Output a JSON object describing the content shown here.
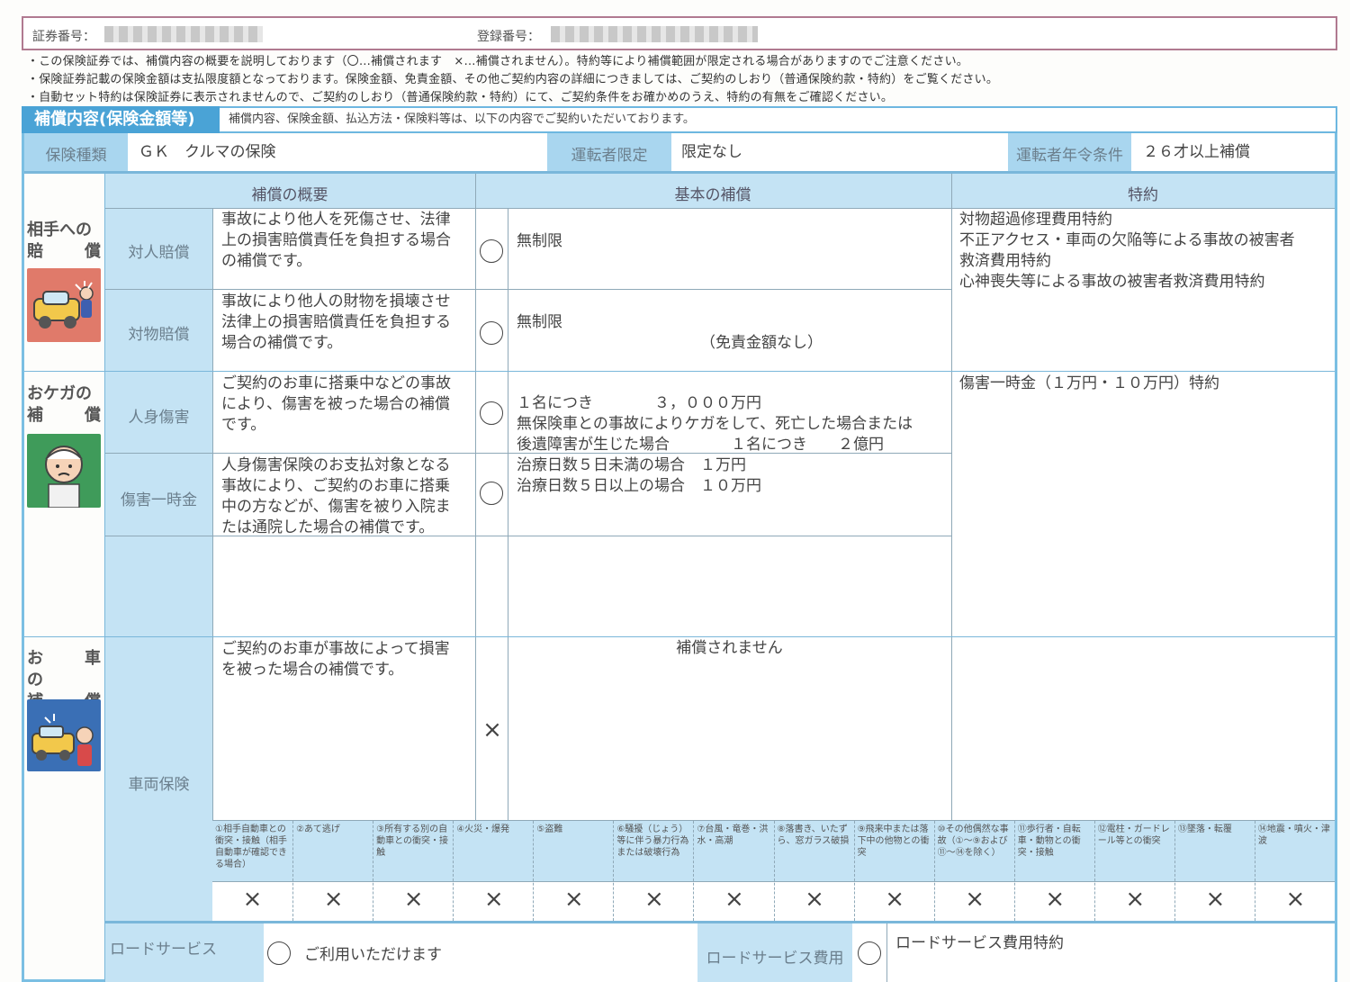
{
  "top": {
    "certificate_label": "証券番号：",
    "registration_label": "登録番号："
  },
  "notes": [
    "・この保険証券では、補償内容の概要を説明しております（〇…補償されます　×…補償されません）。特約等により補償範囲が限定される場合がありますのでご注意ください。",
    "・保険証券記載の保険金額は支払限度額となっております。保険金額、免責金額、その他ご契約内容の詳細につきましては、ご契約のしおり（普通保険約款・特約）をご覧ください。",
    "・自動セット特約は保険証券に表示されませんので、ご契約のしおり（普通保険約款・特約）にて、ご契約条件をお確かめのうえ、特約の有無をご確認ください。"
  ],
  "section": {
    "title": "補償内容(保険金額等)",
    "description": "補償内容、保険金額、払込方法・保険料等は、以下の内容でご契約いただいております。"
  },
  "summary": {
    "insurance_type_label": "保険種類",
    "insurance_type_value": "ＧＫ　クルマの保険",
    "driver_limit_label": "運転者限定",
    "driver_limit_value": "限定なし",
    "age_label": "運転者年令条件",
    "age_value": "２６才以上補償"
  },
  "columns": {
    "overview": "補償の概要",
    "basic": "基本の補償",
    "special": "特約"
  },
  "categories": {
    "opponent": [
      "相手への",
      "賠　　償"
    ],
    "injury": [
      "おケガの",
      "補　　償"
    ],
    "vehicle": [
      "お　車　の",
      "補　　償"
    ]
  },
  "rows": {
    "bodily": {
      "label": "対人賠償",
      "desc": [
        "事故により他人を死傷させ、法律",
        "上の損害賠償責任を負担する場合",
        "の補償です。"
      ],
      "mark": "〇",
      "basic": [
        "無制限"
      ]
    },
    "property": {
      "label": "対物賠償",
      "desc": [
        "事故により他人の財物を損壊させ",
        "法律上の損害賠償責任を負担する",
        "場合の補償です。"
      ],
      "mark": "〇",
      "basic": [
        "無制限"
      ],
      "basic_note": "（免責金額なし）"
    },
    "personal": {
      "label": "人身傷害",
      "desc": [
        "ご契約のお車に搭乗中などの事故",
        "により、傷害を被った場合の補償",
        "です。"
      ],
      "mark": "〇",
      "basic": [
        "１名につき　　　　３，０００万円",
        "無保険車との事故によりケガをして、死亡した場合または",
        "後遺障害が生じた場合　　　　１名につき　　２億円"
      ]
    },
    "lumpsum": {
      "label": "傷害一時金",
      "desc": [
        "人身傷害保険のお支払対象となる",
        "事故により、ご契約のお車に搭乗",
        "中の方などが、傷害を被り入院ま",
        "たは通院した場合の補償です。"
      ],
      "mark": "〇",
      "basic": [
        "治療日数５日未満の場合　１万円",
        "治療日数５日以上の場合　１０万円"
      ]
    },
    "vehicle": {
      "label": "車両保険",
      "desc": [
        "ご契約のお車が事故によって損害",
        "を被った場合の補償です。"
      ],
      "mark": "×",
      "basic": [
        "補償されません"
      ]
    }
  },
  "special_opponent": [
    "対物超過修理費用特約",
    "不正アクセス・車両の欠陥等による事故の被害者",
    "救済費用特約",
    "心神喪失等による事故の被害者救済費用特約"
  ],
  "special_injury": [
    "傷害一時金（１万円・１０万円）特約"
  ],
  "vehicle_categories": [
    {
      "text": "①相手自動車との衝突・接触（相手自動車が確認できる場合）",
      "mark": "×"
    },
    {
      "text": "②あて逃げ",
      "mark": "×"
    },
    {
      "text": "③所有する別の自動車との衝突・接触",
      "mark": "×"
    },
    {
      "text": "④火災・爆発",
      "mark": "×"
    },
    {
      "text": "⑤盗難",
      "mark": "×"
    },
    {
      "text": "⑥騒擾（じょう）等に伴う暴力行為または破壊行為",
      "mark": "×"
    },
    {
      "text": "⑦台風・竜巻・洪水・高潮",
      "mark": "×"
    },
    {
      "text": "⑧落書き、いたずら、窓ガラス破損",
      "mark": "×"
    },
    {
      "text": "⑨飛来中または落下中の他物との衝突",
      "mark": "×"
    },
    {
      "text": "⑩その他偶然な事故（①～⑨および⑪～⑭を除く）",
      "mark": "×"
    },
    {
      "text": "⑪歩行者・自転車・動物との衝突・接触",
      "mark": "×"
    },
    {
      "text": "⑫電柱・ガードレール等との衝突",
      "mark": "×"
    },
    {
      "text": "⑬墜落・転覆",
      "mark": "×"
    },
    {
      "text": "⑭地震・噴火・津波",
      "mark": "×"
    }
  ],
  "road": {
    "label": "ロードサービス",
    "mark": "〇",
    "value": "ご利用いただけます",
    "fee_label": "ロードサービス費用",
    "fee_mark": "〇",
    "fee_value": "ロードサービス費用特約"
  }
}
